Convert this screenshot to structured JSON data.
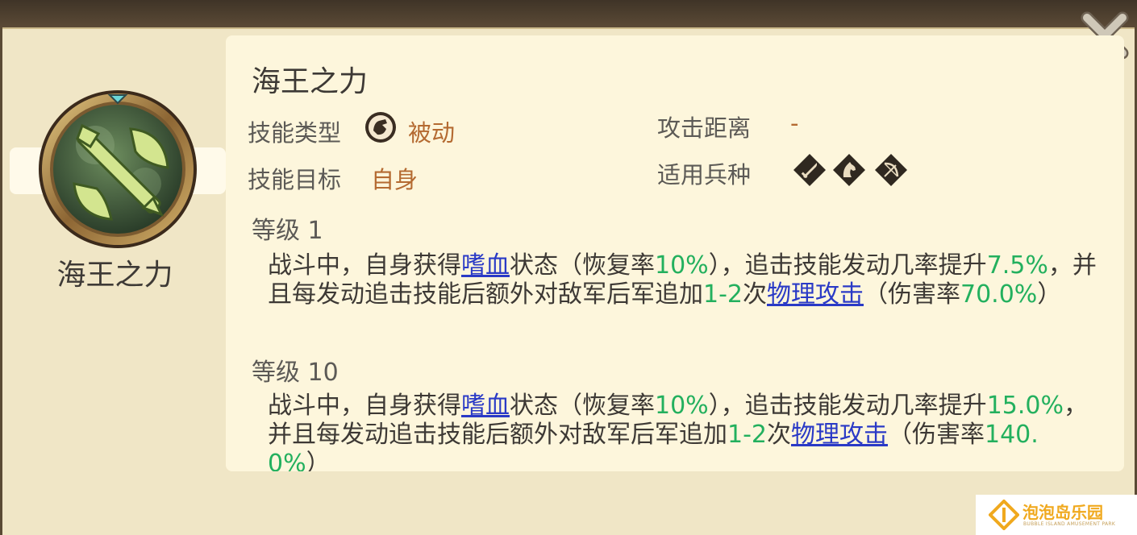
{
  "skill": {
    "title": "海王之力",
    "icon_name": "double-axe-skill-icon",
    "name_under_icon": "海王之力"
  },
  "info": {
    "type_label": "技能类型",
    "type_value": "被动",
    "type_icon": "passive-hand-icon",
    "target_label": "技能目标",
    "target_value": "自身",
    "range_label": "攻击距离",
    "range_value": "-",
    "units_label": "适用兵种",
    "units": [
      "infantry-sword-icon",
      "cavalry-horse-icon",
      "archer-bow-icon"
    ]
  },
  "levels": [
    {
      "heading": "等级 1",
      "p1": "战斗中，自身获得",
      "link1": "嗜血",
      "p2": "状态（恢复率",
      "v1": "10%",
      "p3": "），追击技能发动几率提升",
      "v2": "7.5%",
      "p4": "，并且每发动追击技能后额外对敌军后军追加",
      "v3": "1-2",
      "p5": "次",
      "link2": "物理攻击",
      "p6": "（伤害率",
      "v4": "70.0%",
      "p7": "）"
    },
    {
      "heading": "等级 10",
      "p1": "战斗中，自身获得",
      "link1": "嗜血",
      "p2": "状态（恢复率",
      "v1": "10%",
      "p3": "），追击技能发动几率提升",
      "v2": "15.0%",
      "p4": "，并且每发动追击技能后额外对敌军后军追加",
      "v3": "1-2",
      "p5": "次",
      "link2": "物理攻击",
      "p6": "（伤害率",
      "v4": "140.0%",
      "p7": "）"
    }
  ],
  "watermark": {
    "text": "泡泡岛乐园",
    "sub": "BUBBLE ISLAND AMUSEMENT PARK"
  },
  "colors": {
    "value_orange": "#b46a31",
    "value_green": "#23b05e",
    "link_blue": "#2a3ac6"
  }
}
